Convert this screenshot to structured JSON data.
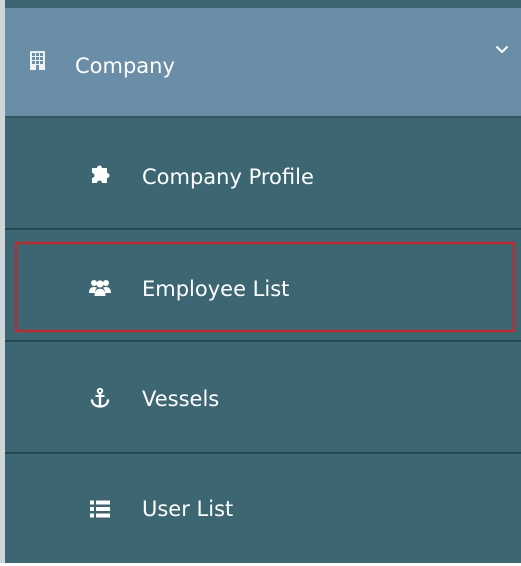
{
  "menu": {
    "parent": {
      "label": "Company",
      "icon": "building-icon",
      "expanded": true
    },
    "items": [
      {
        "label": "Company Profile",
        "icon": "puzzle-icon"
      },
      {
        "label": "Employee List",
        "icon": "users-icon",
        "highlighted": true
      },
      {
        "label": "Vessels",
        "icon": "anchor-icon"
      },
      {
        "label": "User List",
        "icon": "list-icon"
      }
    ]
  },
  "colors": {
    "parent_bg": "#6a8da8",
    "submenu_bg": "#3c6672",
    "text": "#ffffff",
    "highlight_border": "#d82020"
  }
}
